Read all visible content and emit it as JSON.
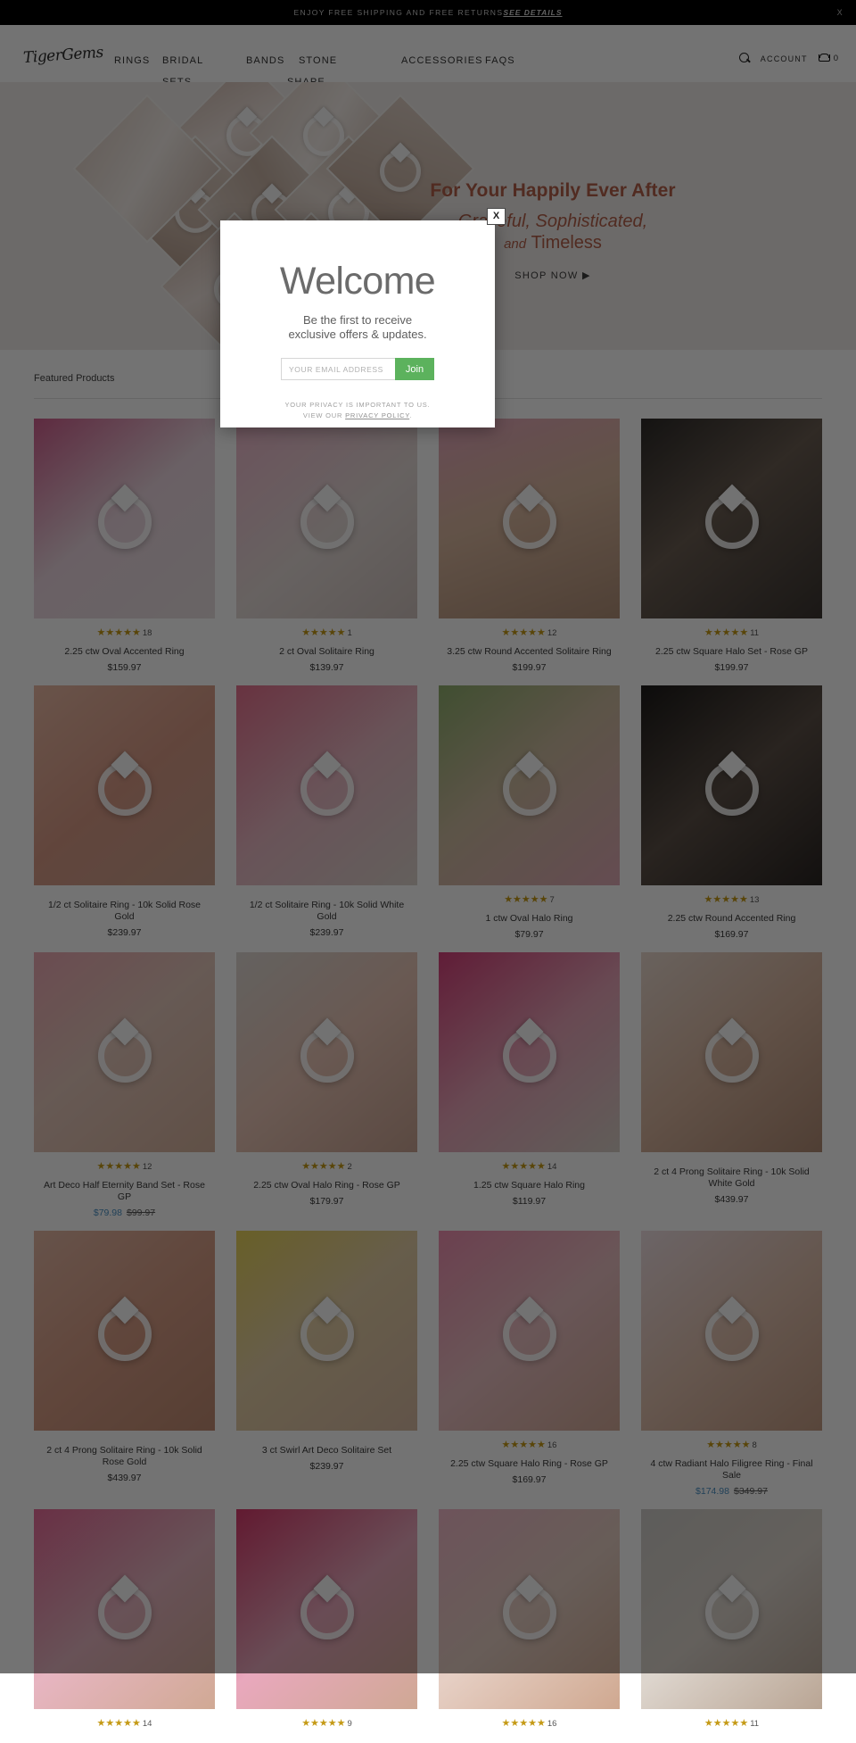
{
  "announcement": {
    "text": "ENJOY FREE SHIPPING AND FREE RETURNS",
    "link_label": "SEE DETAILS",
    "close_label": "X"
  },
  "header": {
    "logo_text": "TigerGems",
    "nav": [
      {
        "label": "RINGS"
      },
      {
        "label": "BRIDAL"
      },
      {
        "label": "BANDS"
      },
      {
        "label": "STONE"
      },
      {
        "label": "ACCESSORIES"
      },
      {
        "label": "FAQS"
      },
      {
        "label": "SETS"
      },
      {
        "label": "SHAPE"
      }
    ],
    "search_icon": "search-icon",
    "account_label": "ACCOUNT",
    "cart_icon": "cart-icon",
    "cart_count": "0"
  },
  "hero": {
    "headline": "For Your Happily Ever After",
    "subline_1": "Graceful, Sophisticated,",
    "subline_and": "and",
    "subline_2": "Timeless",
    "cta_label": "SHOP NOW ▶"
  },
  "featured": {
    "title": "Featured Products",
    "products": [
      {
        "rating": 5,
        "reviews": "18",
        "title": "2.25 ctw Oval Accented Ring",
        "price": "$159.97",
        "sale_price": "",
        "old_price": "",
        "tint": "t01"
      },
      {
        "rating": 5,
        "reviews": "1",
        "title": "2 ct Oval Solitaire Ring",
        "price": "$139.97",
        "sale_price": "",
        "old_price": "",
        "tint": "t02"
      },
      {
        "rating": 5,
        "reviews": "12",
        "title": "3.25 ctw Round Accented Solitaire Ring",
        "price": "$199.97",
        "sale_price": "",
        "old_price": "",
        "tint": "t03"
      },
      {
        "rating": 5,
        "reviews": "11",
        "title": "2.25 ctw Square Halo Set - Rose GP",
        "price": "$199.97",
        "sale_price": "",
        "old_price": "",
        "tint": "t04"
      },
      {
        "rating": 0,
        "reviews": "",
        "title": "1/2 ct Solitaire Ring - 10k Solid Rose Gold",
        "price": "$239.97",
        "sale_price": "",
        "old_price": "",
        "tint": "t05"
      },
      {
        "rating": 0,
        "reviews": "",
        "title": "1/2 ct Solitaire Ring - 10k Solid White Gold",
        "price": "$239.97",
        "sale_price": "",
        "old_price": "",
        "tint": "t06"
      },
      {
        "rating": 5,
        "reviews": "7",
        "title": "1 ctw Oval Halo Ring",
        "price": "$79.97",
        "sale_price": "",
        "old_price": "",
        "tint": "t07"
      },
      {
        "rating": 5,
        "reviews": "13",
        "title": "2.25 ctw Round Accented Ring",
        "price": "$169.97",
        "sale_price": "",
        "old_price": "",
        "tint": "t08"
      },
      {
        "rating": 5,
        "reviews": "12",
        "title": "Art Deco Half Eternity Band Set - Rose GP",
        "price": "",
        "sale_price": "$79.98",
        "old_price": "$99.97",
        "tint": "t09"
      },
      {
        "rating": 5,
        "reviews": "2",
        "title": "2.25 ctw Oval Halo Ring - Rose GP",
        "price": "$179.97",
        "sale_price": "",
        "old_price": "",
        "tint": "t10"
      },
      {
        "rating": 5,
        "reviews": "14",
        "title": "1.25 ctw Square Halo Ring",
        "price": "$119.97",
        "sale_price": "",
        "old_price": "",
        "tint": "t11"
      },
      {
        "rating": 0,
        "reviews": "",
        "title": "2 ct 4 Prong Solitaire Ring - 10k Solid White Gold",
        "price": "$439.97",
        "sale_price": "",
        "old_price": "",
        "tint": "t12"
      },
      {
        "rating": 0,
        "reviews": "",
        "title": "2 ct 4 Prong Solitaire Ring - 10k Solid Rose Gold",
        "price": "$439.97",
        "sale_price": "",
        "old_price": "",
        "tint": "t13"
      },
      {
        "rating": 0,
        "reviews": "",
        "title": "3 ct Swirl Art Deco Solitaire Set",
        "price": "$239.97",
        "sale_price": "",
        "old_price": "",
        "tint": "t14"
      },
      {
        "rating": 5,
        "reviews": "16",
        "title": "2.25 ctw Square Halo Ring - Rose GP",
        "price": "$169.97",
        "sale_price": "",
        "old_price": "",
        "tint": "t15"
      },
      {
        "rating": 5,
        "reviews": "8",
        "title": "4 ctw Radiant Halo Filigree Ring - Final Sale",
        "price": "",
        "sale_price": "$174.98",
        "old_price": "$349.97",
        "tint": "t16"
      },
      {
        "rating": 5,
        "reviews": "14",
        "title": "",
        "price": "",
        "sale_price": "",
        "old_price": "",
        "tint": "t17"
      },
      {
        "rating": 5,
        "reviews": "9",
        "title": "",
        "price": "",
        "sale_price": "",
        "old_price": "",
        "tint": "t18"
      },
      {
        "rating": 5,
        "reviews": "16",
        "title": "",
        "price": "",
        "sale_price": "",
        "old_price": "",
        "tint": "t19"
      },
      {
        "rating": 5,
        "reviews": "11",
        "title": "",
        "price": "",
        "sale_price": "",
        "old_price": "",
        "tint": "t20"
      }
    ]
  },
  "modal": {
    "close_label": "X",
    "title": "Welcome",
    "subtitle_line1": "Be the first to receive",
    "subtitle_line2": "exclusive offers & updates.",
    "email_placeholder": "YOUR EMAIL ADDRESS",
    "email_value": "",
    "join_label": "Join",
    "privacy_line1": "YOUR PRIVACY IS IMPORTANT TO US.",
    "privacy_line2_prefix": "VIEW OUR ",
    "privacy_link": "PRIVACY POLICY",
    "privacy_line2_suffix": "."
  },
  "colors": {
    "accent_green": "#5cb25d",
    "hero_rust": "#b4604a",
    "star_gold": "#c59a16",
    "sale_blue": "#4a90c4"
  }
}
